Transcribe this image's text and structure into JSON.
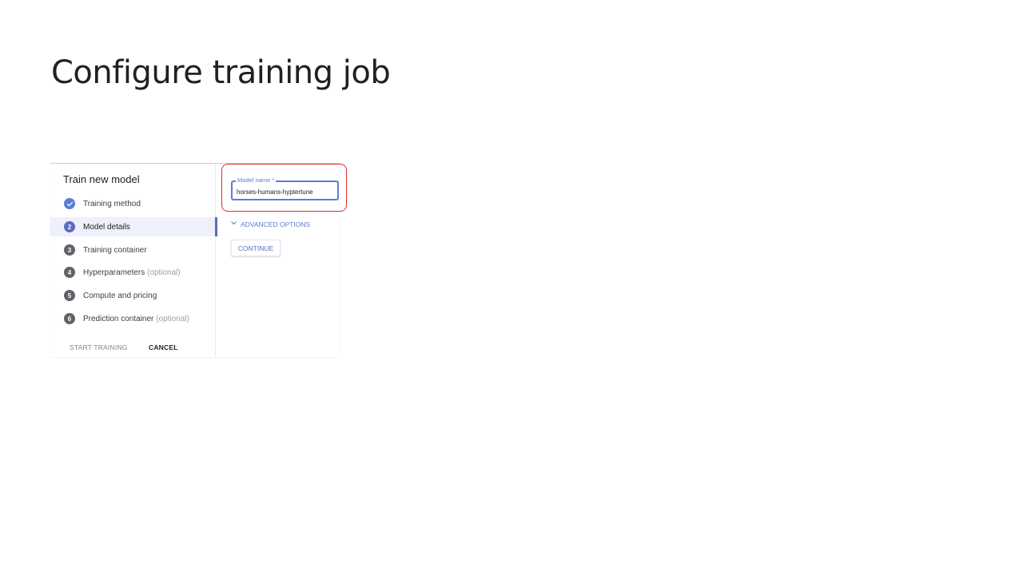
{
  "slide": {
    "title": "Configure training job"
  },
  "dialog": {
    "title": "Train new model",
    "steps": [
      {
        "num": "",
        "label": "Training method",
        "optional": ""
      },
      {
        "num": "2",
        "label": "Model details",
        "optional": ""
      },
      {
        "num": "3",
        "label": "Training container",
        "optional": ""
      },
      {
        "num": "4",
        "label": "Hyperparameters",
        "optional": "(optional)"
      },
      {
        "num": "5",
        "label": "Compute and pricing",
        "optional": ""
      },
      {
        "num": "6",
        "label": "Prediction container",
        "optional": "(optional)"
      }
    ],
    "start_label": "START TRAINING",
    "cancel_label": "CANCEL"
  },
  "form": {
    "model_name_label": "Model name *",
    "model_name_value": "horses-humans-hyptertune",
    "advanced_label": "ADVANCED OPTIONS",
    "continue_label": "CONTINUE"
  },
  "colors": {
    "accent": "#5c6bc0",
    "highlight": "#d93025"
  }
}
